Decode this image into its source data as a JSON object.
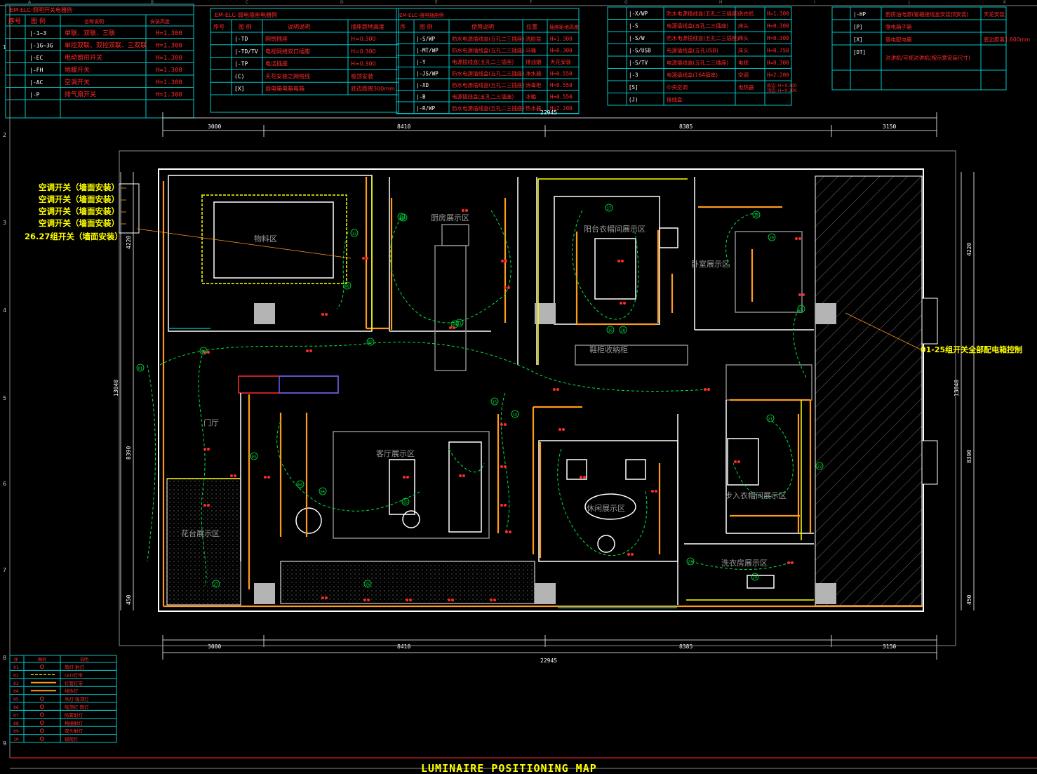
{
  "title": "LUMINAIRE POSITIONING MAP",
  "colors": {
    "bg": "#000000",
    "frame": "#ffffff",
    "table": "#00c8c8",
    "red": "#ff2a2a",
    "yellow": "#ffff00",
    "orange": "#ff9a1a",
    "green": "#00e640",
    "gray": "#8c8c8c",
    "dim": "#6e6e6e"
  },
  "legend_switch": {
    "title": "EM-ELC-照明开关电器例",
    "headers": [
      "序号",
      "图 例",
      "名称说明",
      "安装高度"
    ],
    "rows": [
      {
        "sym": "|-1~3",
        "desc": "单联、双联、三联",
        "h": "H=1.300"
      },
      {
        "sym": "|-1G~3G",
        "desc": "单控双联、双控双联、三双联",
        "h": "H=1.300"
      },
      {
        "sym": "|-EC",
        "desc": "电动窗帘开关",
        "h": "H=1.300"
      },
      {
        "sym": "|-FH",
        "desc": "地暖开关",
        "h": "H=1.300"
      },
      {
        "sym": "|-AC",
        "desc": "空调开关",
        "h": "H=1.300"
      },
      {
        "sym": "|-P",
        "desc": "排气扇开关",
        "h": "H=1.300"
      }
    ]
  },
  "legend_weak": {
    "title": "EM-ELC-弱电插座电器例",
    "headers": [
      "序号",
      "图 例",
      "说明说明",
      "插座距地高度"
    ],
    "rows": [
      {
        "sym": "|-TD",
        "desc": "网络插座",
        "h": "H=0.300"
      },
      {
        "sym": "|-TD/TV",
        "desc": "电视网络双口插座",
        "h": "H=0.300"
      },
      {
        "sym": "|-TP",
        "desc": "电话插座",
        "h": "H=0.300"
      },
      {
        "sym": "(C)",
        "desc": "天花安装之网络线",
        "h": "吸顶安装"
      },
      {
        "sym": "[X]",
        "desc": "弱电箱电箱电箱",
        "h": "底边距离300mm"
      }
    ]
  },
  "legend_power": {
    "title": "EM-ELC-强电插座例",
    "headers": [
      "序",
      "图 例",
      "使用说明",
      "位置",
      "插座距地高度"
    ],
    "rows": [
      {
        "sym": "|-S/WP",
        "desc": "防水电源插线盒(五孔二三插座)",
        "pos": "洗脸盆",
        "h": "H=1.300"
      },
      {
        "sym": "|-MT/WP",
        "desc": "防水电源插线盒(五孔二三插座)",
        "pos": "马桶",
        "h": "H=0.300"
      },
      {
        "sym": "|-Y",
        "desc": "电源插线盒(五孔二三插座)",
        "pos": "排油烟",
        "h": "天花安装"
      },
      {
        "sym": "|-JS/WP",
        "desc": "防水电源插线盒(五孔二三插座)",
        "pos": "净水器",
        "h": "H=0.550"
      },
      {
        "sym": "|-XD",
        "desc": "防水电源插线盒(五孔二三插座)",
        "pos": "消毒柜",
        "h": "H=0.550"
      },
      {
        "sym": "|-B",
        "desc": "电源插线盒(五孔二三插座)",
        "pos": "冰箱",
        "h": "H=0.550"
      },
      {
        "sym": "|-R/WP",
        "desc": "防水电源插线盒(五孔二三插座)",
        "pos": "热水器",
        "h": "H=2.200"
      }
    ]
  },
  "legend_power2": {
    "rows": [
      {
        "sym": "|-X/WP",
        "desc": "防水电源插线盒(五孔二三插座)",
        "pos": "洗衣机",
        "h": "H=1.300"
      },
      {
        "sym": "|-S",
        "desc": "电源插线盒(五孔二三插座)",
        "pos": "床头",
        "h": "H=0.300"
      },
      {
        "sym": "|-S/W",
        "desc": "防水电源插线盒(五孔二三插座)",
        "pos": "床头",
        "h": "H=0.300"
      },
      {
        "sym": "|-S/USB",
        "desc": "电源插线盒(五孔USB)",
        "pos": "床头",
        "h": "H=0.750"
      },
      {
        "sym": "|-S/TV",
        "desc": "电源插线盒(五孔二三插座)",
        "pos": "电视",
        "h": "H=0.300"
      },
      {
        "sym": "|-3",
        "desc": "电源插线盒(16A插座)",
        "pos": "空调",
        "h": "H=2.200"
      },
      {
        "sym": "[S]",
        "desc": "中央空调",
        "pos": "电热器",
        "h": "底边: H=0.300 顶边: H=0.300"
      },
      {
        "sym": "(J)",
        "desc": "接线盒",
        "pos": "",
        "h": ""
      }
    ]
  },
  "legend_misc": {
    "rows": [
      {
        "sym": "|-HP",
        "desc": "厨房油电源(管箱接线盒安装顶安装)",
        "h": "天花安装"
      },
      {
        "sym": "[P]",
        "desc": "强电箱子箱",
        "h": ""
      },
      {
        "sym": "[X]",
        "desc": "弱电配电箱",
        "h": "底边距离1.600mm"
      },
      {
        "sym": "[DT]",
        "desc": "对讲机/可视对讲机(按示意安装尺寸)",
        "h": ""
      }
    ]
  },
  "legend_lights": {
    "headers": [
      "序",
      "图例",
      "说明"
    ],
    "rows": [
      {
        "no": "01",
        "desc": "筒灯 射灯"
      },
      {
        "no": "02",
        "desc": "LED灯带"
      },
      {
        "no": "03",
        "desc": "灯管灯带"
      },
      {
        "no": "04",
        "desc": "线性灯"
      },
      {
        "no": "05",
        "desc": "吊灯 吸顶灯"
      },
      {
        "no": "06",
        "desc": "吸顶灯 筒灯"
      },
      {
        "no": "07",
        "desc": "防雾射灯"
      },
      {
        "no": "08",
        "desc": "格栅射灯"
      },
      {
        "no": "09",
        "desc": "双头射灯"
      },
      {
        "no": "10",
        "desc": "镜前灯"
      }
    ]
  },
  "dimensions": {
    "top_segments": [
      "3000",
      "8410",
      "8385",
      "3150"
    ],
    "total": "22945",
    "left": [
      "4220",
      "13040",
      "8390",
      "450"
    ],
    "right": [
      "4220",
      "13040",
      "8390",
      "450"
    ]
  },
  "grid_letters": [
    "A",
    "B",
    "C",
    "D",
    "E",
    "F",
    "G",
    "H",
    "I",
    "J",
    "K"
  ],
  "grid_numbers": [
    "1",
    "2",
    "3",
    "4",
    "5",
    "6",
    "7",
    "8",
    "9"
  ],
  "rooms": [
    {
      "id": "storage",
      "label": "物料区"
    },
    {
      "id": "kitchen",
      "label": "厨房展示区"
    },
    {
      "id": "cloak",
      "label": "阳台衣帽间展示区"
    },
    {
      "id": "bedroom",
      "label": "卧室展示区"
    },
    {
      "id": "foyer",
      "label": "门厅"
    },
    {
      "id": "living",
      "label": "客厅展示区"
    },
    {
      "id": "leisure",
      "label": "休闲展示区"
    },
    {
      "id": "walkin",
      "label": "步入衣帽间展示区"
    },
    {
      "id": "laundry",
      "label": "洗衣房展示区"
    },
    {
      "id": "planter",
      "label": "花台展示区"
    },
    {
      "id": "shoe",
      "label": "鞋柜收纳柜"
    }
  ],
  "callouts_left": [
    "空调开关（墙面安装）",
    "空调开关（墙面安装）",
    "空调开关（墙面安装）",
    "空调开关（墙面安装）",
    "26.27组开关（墙面安装）"
  ],
  "callout_right": "01-25组开关全部配电箱控制",
  "circuits": [
    "01",
    "02",
    "03",
    "04",
    "05",
    "06",
    "07",
    "08",
    "09",
    "10",
    "11",
    "12",
    "13",
    "14",
    "15",
    "16",
    "17",
    "18",
    "19",
    "20",
    "21",
    "22",
    "23",
    "24",
    "25",
    "26",
    "27"
  ]
}
